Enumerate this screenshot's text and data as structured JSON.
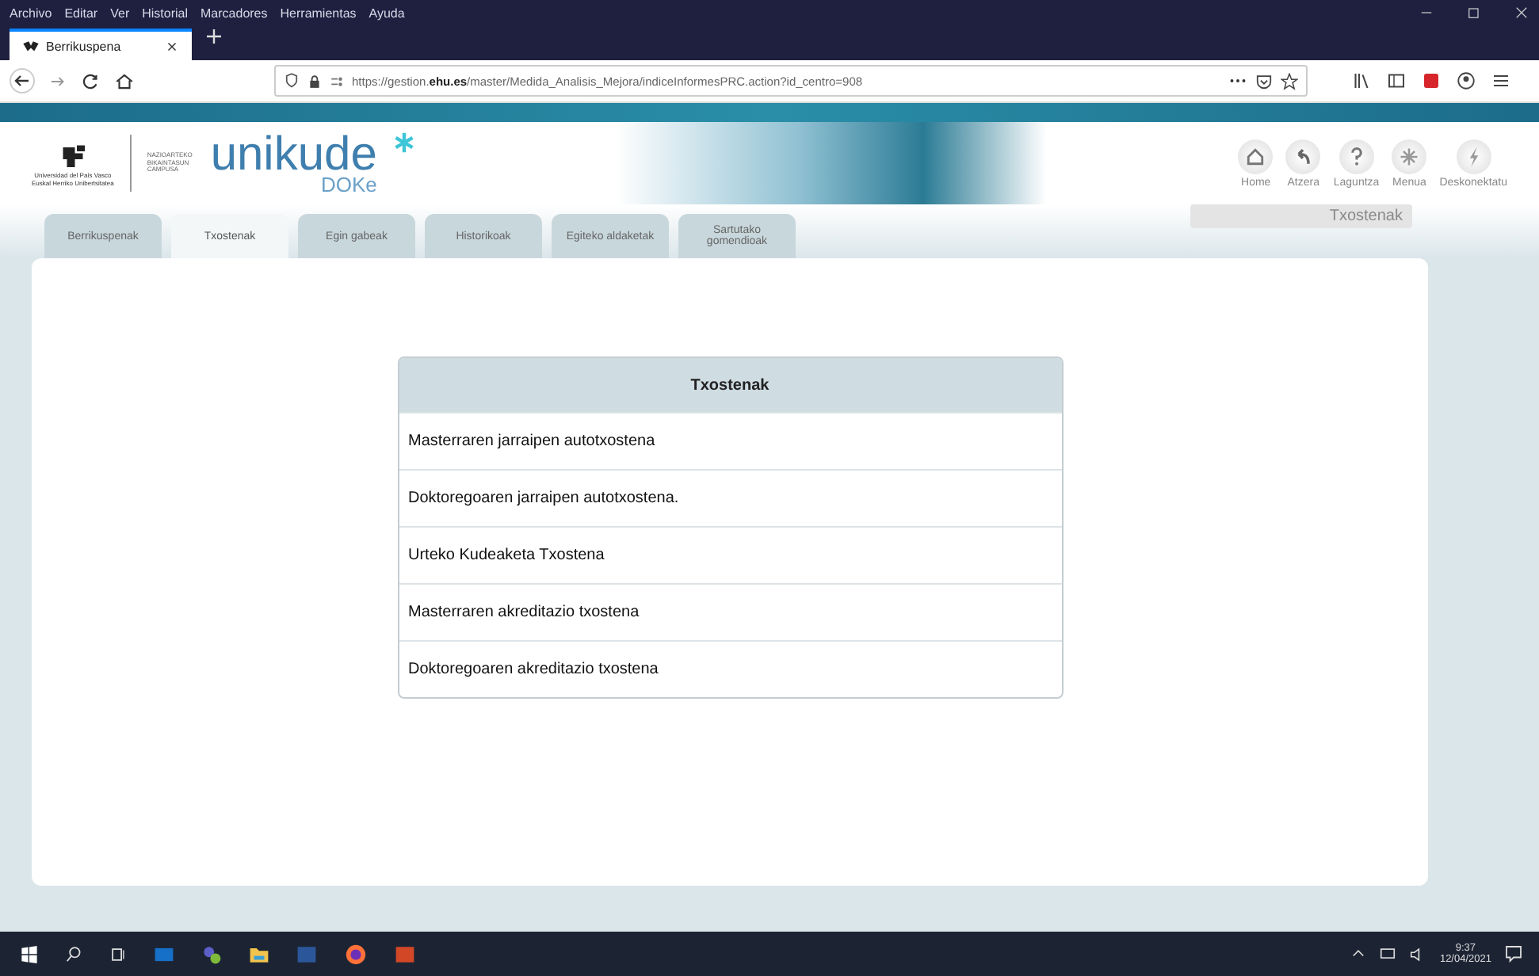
{
  "browser": {
    "menu": [
      "Archivo",
      "Editar",
      "Ver",
      "Historial",
      "Marcadores",
      "Herramientas",
      "Ayuda"
    ],
    "tab": {
      "title": "Berrikuspena"
    },
    "url": {
      "prefix": "https://gestion.",
      "domain": "ehu.es",
      "path": "/master/Medida_Analisis_Mejora/indiceInformesPRC.action?id_centro=908"
    }
  },
  "header": {
    "university": [
      "Universidad del País Vasco",
      "Euskal Herriko Unibertsitatea"
    ],
    "campus": "NAZIOARTEKO BIKAINTASUN CAMPUSA",
    "brand": "unikude",
    "sub_brand": "DOKe",
    "actions": [
      {
        "label": "Home",
        "kind": "home"
      },
      {
        "label": "Atzera",
        "kind": "back"
      },
      {
        "label": "Laguntza",
        "kind": "help"
      },
      {
        "label": "Menua",
        "kind": "menu"
      },
      {
        "label": "Deskonektatu",
        "kind": "logout"
      }
    ],
    "breadcrumb": "Txostenak"
  },
  "tabs": [
    {
      "label": "Berrikuspenak",
      "selected": false
    },
    {
      "label": "Txostenak",
      "selected": true
    },
    {
      "label": "Egin gabeak",
      "selected": false
    },
    {
      "label": "Historikoak",
      "selected": false
    },
    {
      "label": "Egiteko aldaketak",
      "selected": false
    },
    {
      "label": "Sartutako gomendioak",
      "selected": false
    }
  ],
  "table": {
    "header": "Txostenak",
    "rows": [
      "Masterraren jarraipen autotxostena",
      "Doktoregoaren jarraipen autotxostena.",
      "Urteko Kudeaketa Txostena",
      "Masterraren akreditazio txostena",
      "Doktoregoaren akreditazio txostena"
    ]
  },
  "taskbar": {
    "time": "9:37",
    "date": "12/04/2021"
  }
}
